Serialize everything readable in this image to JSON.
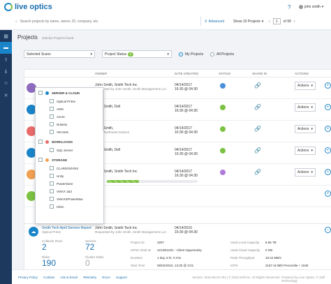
{
  "app": {
    "logo_text": "live optics"
  },
  "topbar": {
    "search_placeholder": "Search projects by name, owner, ID, company, etc.",
    "advanced_label": "Advanced",
    "show_projects_label": "Show 10 Projects",
    "page_current": "1",
    "page_total": "of 99",
    "help_label": "?",
    "user_name": "john smith"
  },
  "page": {
    "title": "Projects",
    "count": "100clus Projects found"
  },
  "filters": {
    "scans_label": "Selected Scans",
    "status_label": "Project Status",
    "status_count": "3",
    "my_projects_label": "My Projects",
    "all_projects_label": "All Projects"
  },
  "table": {
    "headers": {
      "owner": "OWNER",
      "date": "DATE CREATED",
      "status": "STATUS",
      "share": "SHARE IN",
      "actions": "ACTIONS"
    },
    "rows": [
      {
        "owner": "John Smith, Smith Tech Inc",
        "sub": "Requested by John Smith, Smith Management LLC",
        "date": "04/14/2017",
        "time": "16:30 @ 04:30",
        "color": "#8e6bbf",
        "status_color": "#4a90d9"
      },
      {
        "owner": "John Smith, Dell",
        "sub": "",
        "date": "04/14/2017",
        "time": "16:30 @ 04:30",
        "color": "#1a84c8",
        "status_color": "#7cc142"
      },
      {
        "owner": "John Smith,",
        "sub": "Smith Northeast Division",
        "date": "04/14/2017",
        "time": "16:30 @ 04:30",
        "color": "#e86a6a",
        "status_color": "#7cc142"
      },
      {
        "owner": "John Smith, Dell",
        "sub": "",
        "date": "04/14/2017",
        "time": "16:30 @ 04:30",
        "color": "#1a84c8",
        "status_color": "#7cc142"
      },
      {
        "owner": "John Smith, Smith Tech Inc",
        "sub": "",
        "date": "04/14/2017",
        "time": "16:30 @ 04:30",
        "color": "#f0a050",
        "status_color": "#b07ad9"
      },
      {
        "owner": "",
        "sub": "",
        "date": "",
        "time": "",
        "color": "#7cc142",
        "status_color": "#cccccc"
      }
    ],
    "actions_label": "Actions",
    "progress": 0.35
  },
  "detail": {
    "title": "Smith Tech April Servers Report",
    "subtitle": "Optical Prime",
    "owner": "John Smith, Smith Tech Inc",
    "owner_sub": "Requested by John Smith, Smith Management LLC",
    "date": "04/14/2015",
    "time": "16:30 @ 04:30",
    "stats": [
      {
        "label": "Collector Runs",
        "value": "2"
      },
      {
        "label": "Servers",
        "value": "72"
      },
      {
        "label": "Disks",
        "value": "190"
      },
      {
        "label": "Cluster Disks",
        "value": "0"
      }
    ],
    "kv_left": [
      {
        "k": "Project ID",
        "v": "3297"
      },
      {
        "k": "OPSC Deal ID",
        "v": "4213/61201 - Client Opportunity"
      },
      {
        "k": "Duration",
        "v": "1 day, 6 hr, 0 min"
      },
      {
        "k": "Start Time",
        "v": "06/02/2015, 13:30 @ 3:01"
      },
      {
        "k": "End Time",
        "v": "06/03/2015, 18:30 @ 3:01"
      }
    ],
    "kv_right": [
      {
        "k": "Used Local Capacity",
        "v": "8.65 TB"
      },
      {
        "k": "Used Cloud Capacity",
        "v": "0 GB"
      },
      {
        "k": "Peak Throughput",
        "v": "18.42 MB/s"
      },
      {
        "k": "IOPS",
        "v": "2167 at 95th Percentile + 1048"
      },
      {
        "k": "Read/Write Ratio",
        "v": "51% reads/49% writes"
      }
    ]
  },
  "dropdown": {
    "groups": [
      {
        "label": "SERVER & CLOUD",
        "items": [
          "Optical Prime",
          "AWS",
          "Azure",
          "Nutanix",
          "VM Sets"
        ]
      },
      {
        "label": "WORKLOADS",
        "items": [
          "SQL Server"
        ]
      },
      {
        "label": "STORAGE",
        "items": [
          "CLARiiON/VNX",
          "Unity",
          "PowerStore",
          "VMAX 1&2",
          "VMAX3/PowerMax",
          "Isilon"
        ]
      }
    ]
  },
  "footer": {
    "links": [
      "Privacy Policy",
      "Cookies",
      "Ads & Email",
      "Telemetry",
      "EULA",
      "Support"
    ],
    "version": "Version: 2019.08.02 #01 | © 2022 Dell Inc. All Rights Reserved",
    "powered": "Powered by Live Optics, © Dell Technology"
  },
  "colors": {
    "accent": "#1a84c8",
    "sidebar": "#1d3a5e",
    "green": "#7cc142"
  }
}
